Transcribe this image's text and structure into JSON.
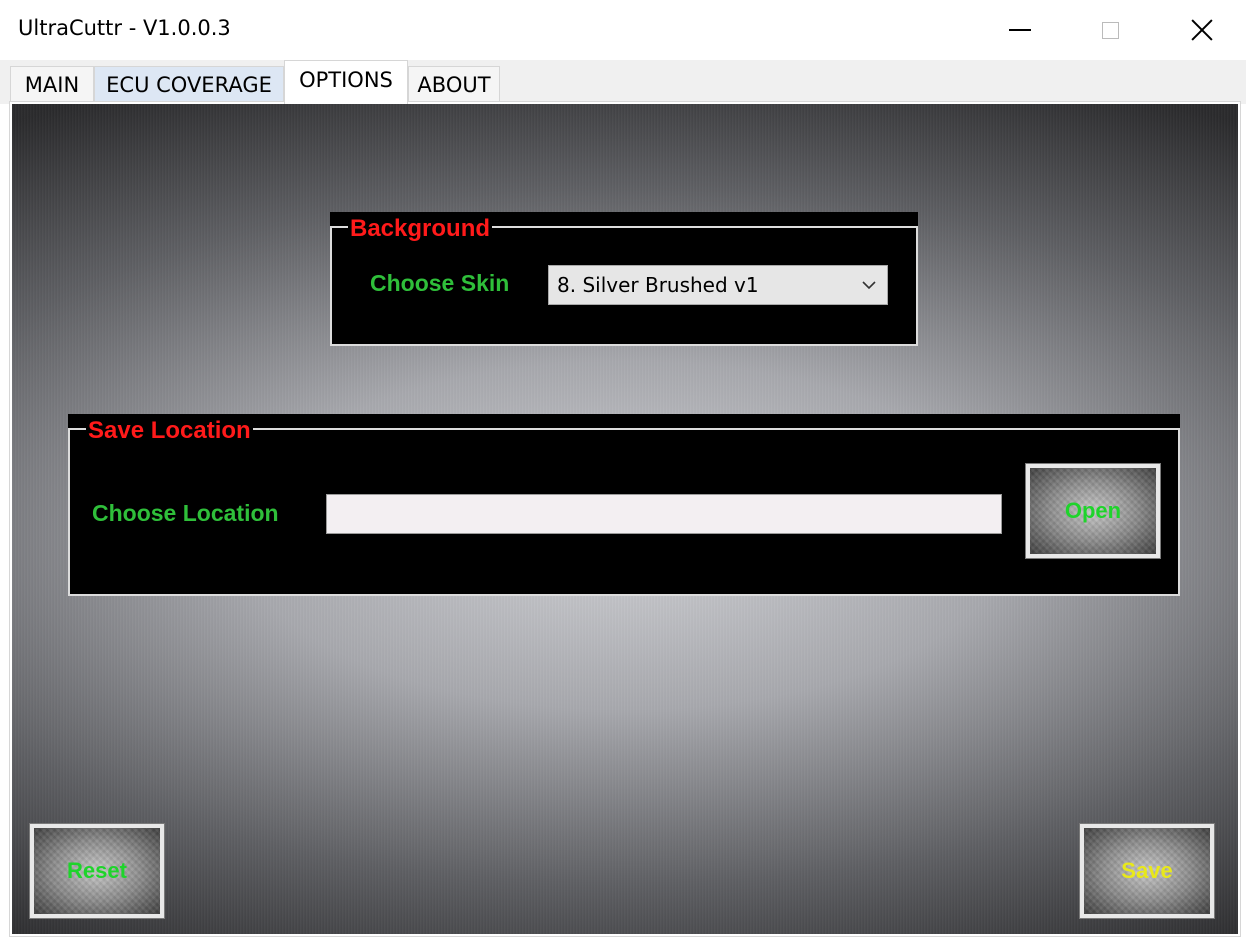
{
  "window": {
    "title": "UltraCuttr - V1.0.0.3"
  },
  "tabs": [
    {
      "label": "MAIN"
    },
    {
      "label": "ECU COVERAGE"
    },
    {
      "label": "OPTIONS"
    },
    {
      "label": "ABOUT"
    }
  ],
  "active_tab": "OPTIONS",
  "background_group": {
    "legend": "Background",
    "skin_label": "Choose Skin",
    "skin_selected": "8. Silver Brushed v1"
  },
  "save_location_group": {
    "legend": "Save Location",
    "location_label": "Choose Location",
    "location_value": "",
    "open_label": "Open"
  },
  "footer": {
    "reset_label": "Reset",
    "save_label": "Save"
  },
  "colors": {
    "legend_red": "#ff1a1a",
    "label_green": "#2fbf3a",
    "button_green": "#1ed42b",
    "button_yellow": "#e8e81a"
  },
  "icons": {
    "minimize": "minimize-icon",
    "maximize": "maximize-icon",
    "close": "close-icon",
    "dropdown": "chevron-down-icon"
  }
}
